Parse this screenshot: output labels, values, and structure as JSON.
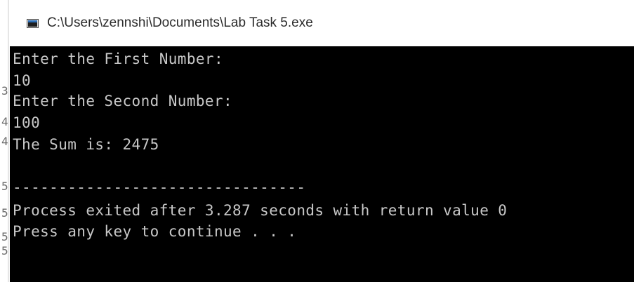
{
  "window": {
    "title": "C:\\Users\\zennshi\\Documents\\Lab Task 5.exe",
    "icon": "console-app-icon"
  },
  "console": {
    "lines": [
      "Enter the First Number:",
      "10",
      "Enter the Second Number:",
      "100",
      "The Sum is: 2475",
      "",
      "--------------------------------",
      "Process exited after 3.287 seconds with return value 0",
      "Press any key to continue . . ."
    ],
    "colors": {
      "background": "#000000",
      "text": "#c8c8c8"
    }
  },
  "background_glyphs": [
    "3",
    "4",
    "4",
    "5",
    "5",
    "5",
    "5"
  ]
}
